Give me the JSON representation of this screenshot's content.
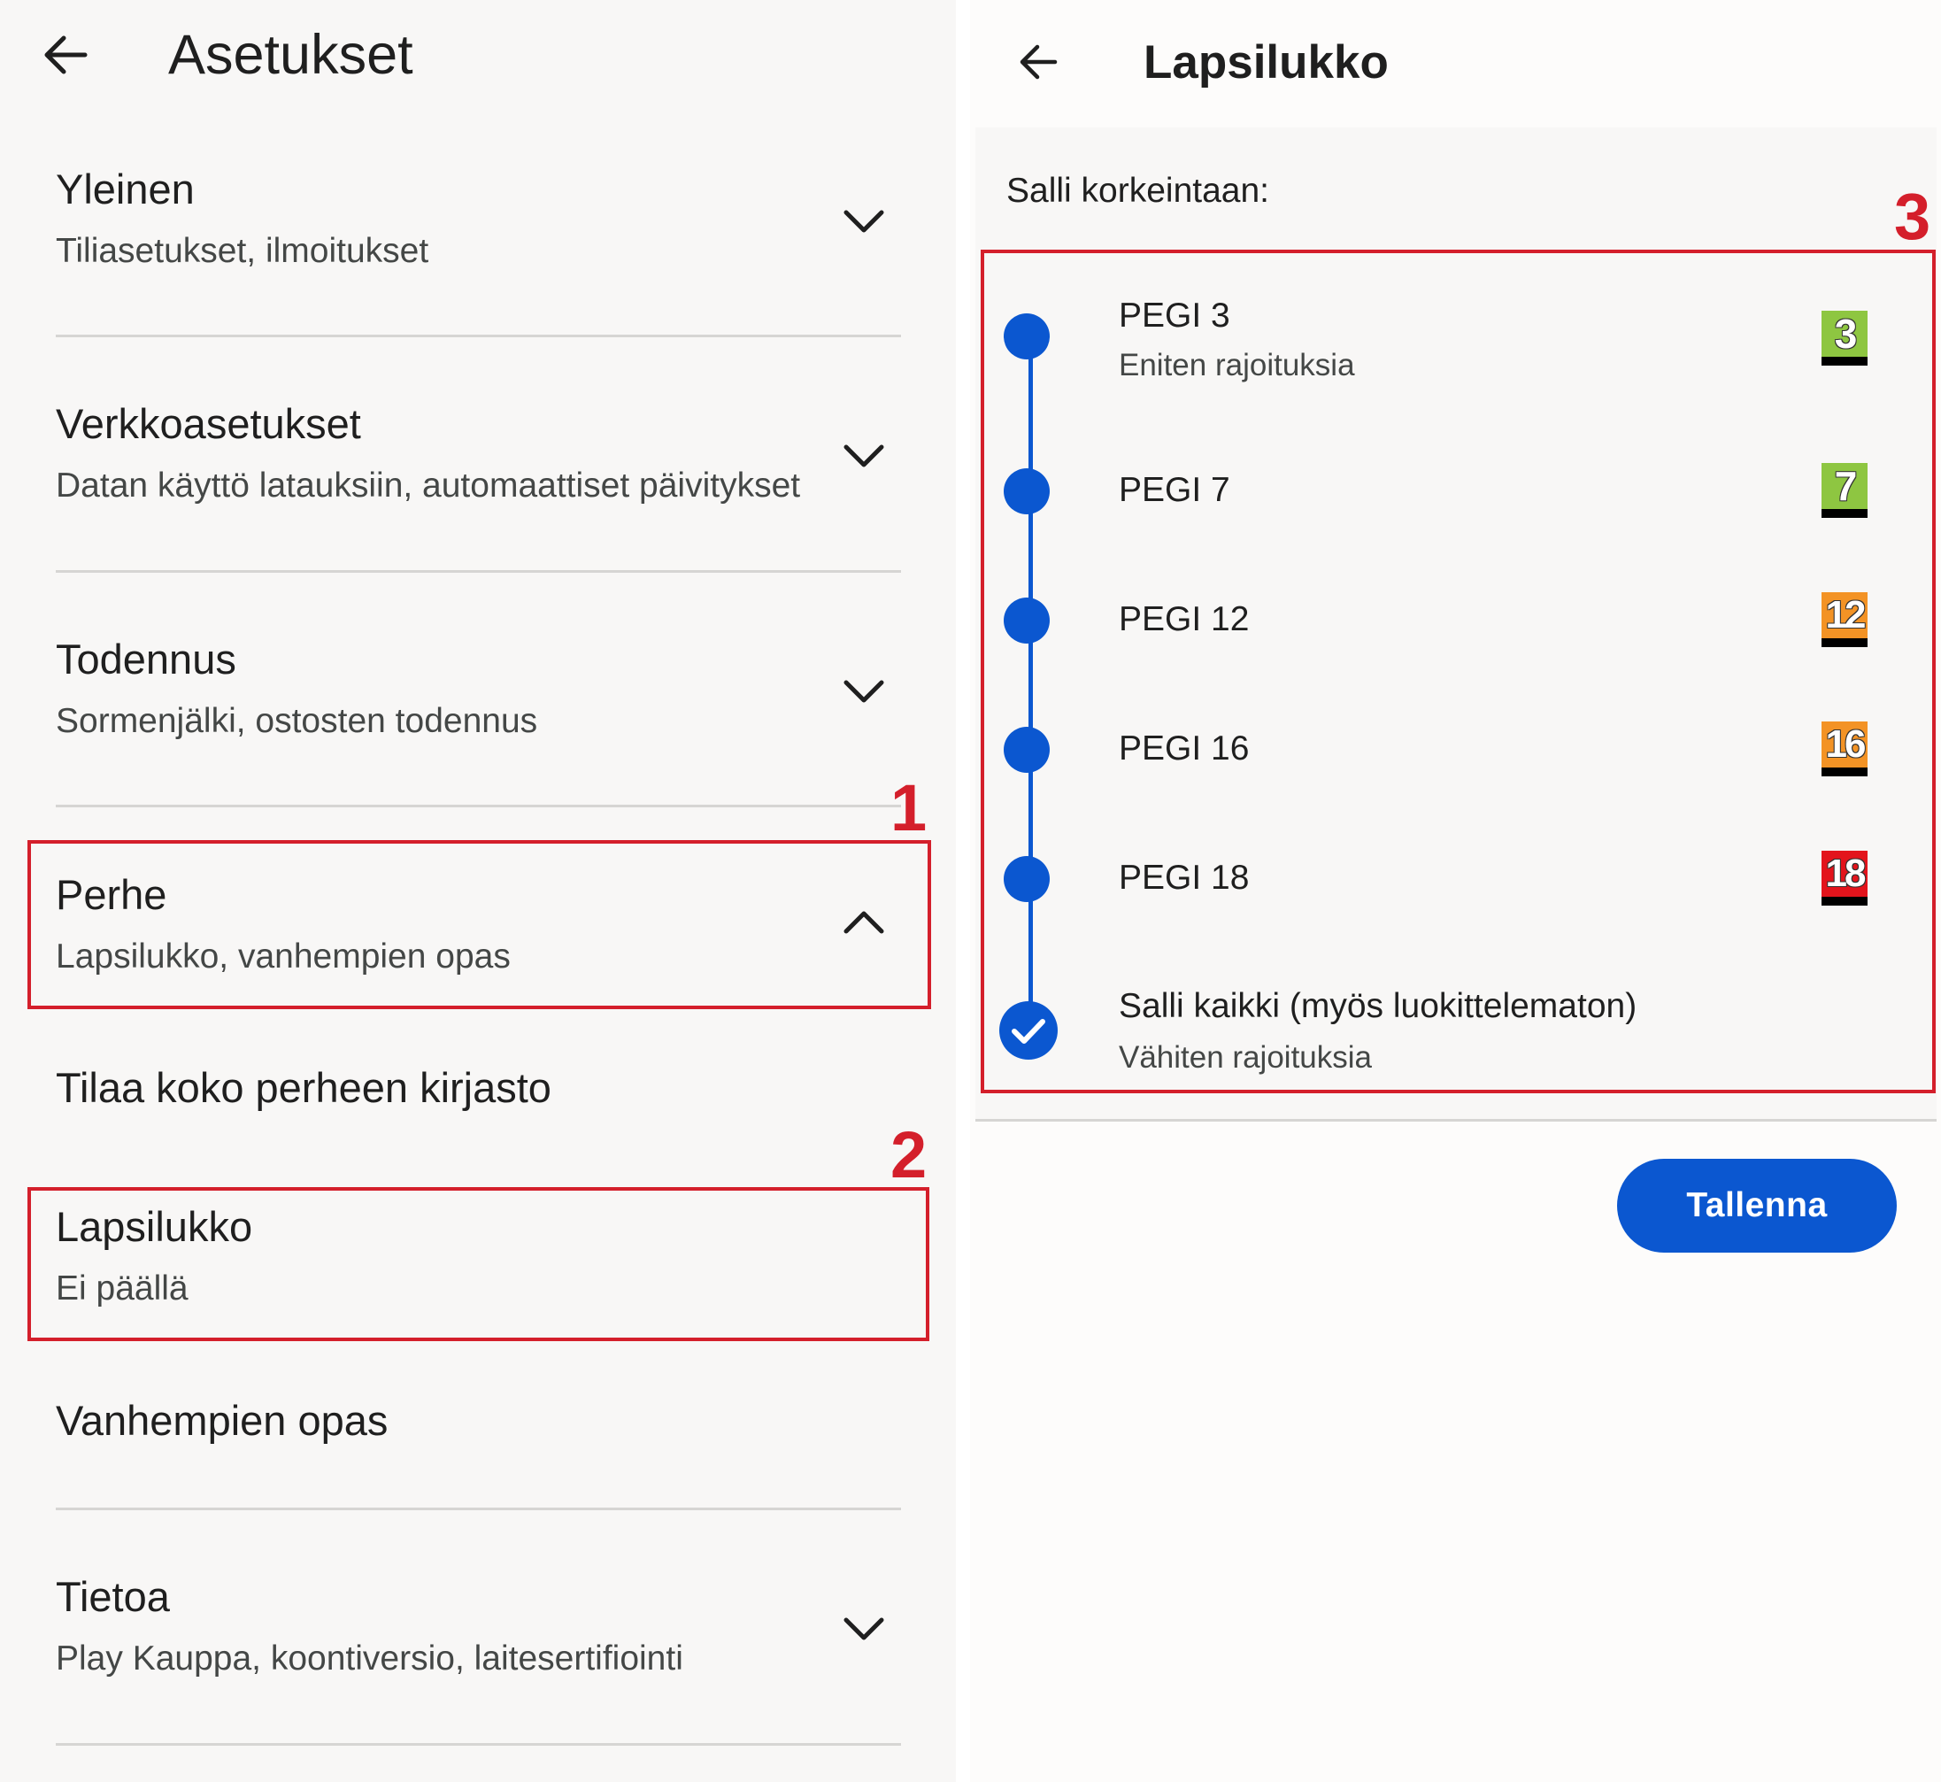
{
  "settings": {
    "title": "Asetukset",
    "sections": [
      {
        "title": "Yleinen",
        "subtitle": "Tiliasetukset, ilmoitukset",
        "expanded": false
      },
      {
        "title": "Verkkoasetukset",
        "subtitle": "Datan käyttö latauksiin, automaattiset päivitykset",
        "expanded": false
      },
      {
        "title": "Todennus",
        "subtitle": "Sormenjälki, ostosten todennus",
        "expanded": false
      },
      {
        "title": "Perhe",
        "subtitle": "Lapsilukko, vanhempien opas",
        "expanded": true
      },
      {
        "title": "Tietoa",
        "subtitle": "Play Kauppa, koontiversio, laitesertifiointi",
        "expanded": false
      }
    ],
    "family_items": [
      {
        "title": "Tilaa koko perheen kirjasto"
      },
      {
        "title": "Lapsilukko",
        "subtitle": "Ei päällä"
      },
      {
        "title": "Vanhempien opas"
      }
    ]
  },
  "parental": {
    "title": "Lapsilukko",
    "allow_label": "Salli korkeintaan:",
    "options": [
      {
        "label": "PEGI 3",
        "sub": "Eniten rajoituksia",
        "badge": "3",
        "badge_color": "#8ec641",
        "selected": false
      },
      {
        "label": "PEGI 7",
        "sub": "",
        "badge": "7",
        "badge_color": "#8ec641",
        "selected": false
      },
      {
        "label": "PEGI 12",
        "sub": "",
        "badge": "12",
        "badge_color": "#f39325",
        "selected": false
      },
      {
        "label": "PEGI 16",
        "sub": "",
        "badge": "16",
        "badge_color": "#f39325",
        "selected": false
      },
      {
        "label": "PEGI 18",
        "sub": "",
        "badge": "18",
        "badge_color": "#e3141c",
        "selected": false
      },
      {
        "label": "Salli kaikki (myös luokittelematon)",
        "sub": "Vähiten rajoituksia",
        "badge": "",
        "selected": true
      }
    ],
    "save_label": "Tallenna"
  },
  "annotations": [
    "1",
    "2",
    "3"
  ],
  "colors": {
    "accent": "#0b57d0",
    "highlight": "#d41f2b"
  }
}
